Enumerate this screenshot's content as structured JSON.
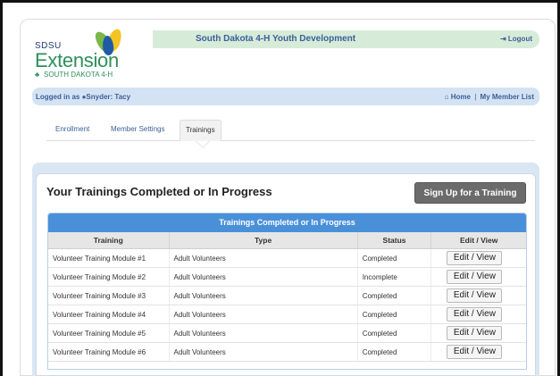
{
  "logo": {
    "line1": "SDSU",
    "line2": "Extension",
    "line3": "SOUTH DAKOTA 4-H",
    "clover_icon": "clover-icon"
  },
  "header": {
    "title": "South Dakota 4-H Youth Development",
    "logout_label": "Logout",
    "logout_icon": "sign-out-icon"
  },
  "login_bar": {
    "prefix": "Logged in as",
    "user_icon": "user-icon",
    "user_name": "Snyder: Tacy",
    "home_icon": "home-icon",
    "home_label": "Home",
    "separator": "|",
    "member_list_label": "My Member List"
  },
  "tabs": [
    {
      "label": "Enrollment",
      "active": false
    },
    {
      "label": "Member Settings",
      "active": false
    },
    {
      "label": "Trainings",
      "active": true
    }
  ],
  "section": {
    "title": "Your Trainings Completed or In Progress",
    "signup_label": "Sign Up for a Training"
  },
  "table": {
    "caption": "Trainings Completed or In Progress",
    "headers": [
      "Training",
      "Type",
      "Status",
      "Edit / View"
    ],
    "rows": [
      {
        "training": "Volunteer Training Module #1",
        "type": "Adult Volunteers",
        "status": "Completed",
        "action": "Edit / View"
      },
      {
        "training": "Volunteer Training Module #2",
        "type": "Adult Volunteers",
        "status": "Incomplete",
        "action": "Edit / View"
      },
      {
        "training": "Volunteer Training Module #3",
        "type": "Adult Volunteers",
        "status": "Completed",
        "action": "Edit / View"
      },
      {
        "training": "Volunteer Training Module #4",
        "type": "Adult Volunteers",
        "status": "Completed",
        "action": "Edit / View"
      },
      {
        "training": "Volunteer Training Module #5",
        "type": "Adult Volunteers",
        "status": "Completed",
        "action": "Edit / View"
      },
      {
        "training": "Volunteer Training Module #6",
        "type": "Adult Volunteers",
        "status": "Completed",
        "action": "Edit / View"
      }
    ]
  },
  "colors": {
    "header_bg": "#d7ebd9",
    "login_bar_bg": "#d4e3f3",
    "link_blue": "#3c6098",
    "table_caption_bg": "#4a90d9",
    "signup_btn_bg": "#6b6b6b",
    "logo_green": "#2f8f5b",
    "logo_blue": "#1f3b73"
  }
}
